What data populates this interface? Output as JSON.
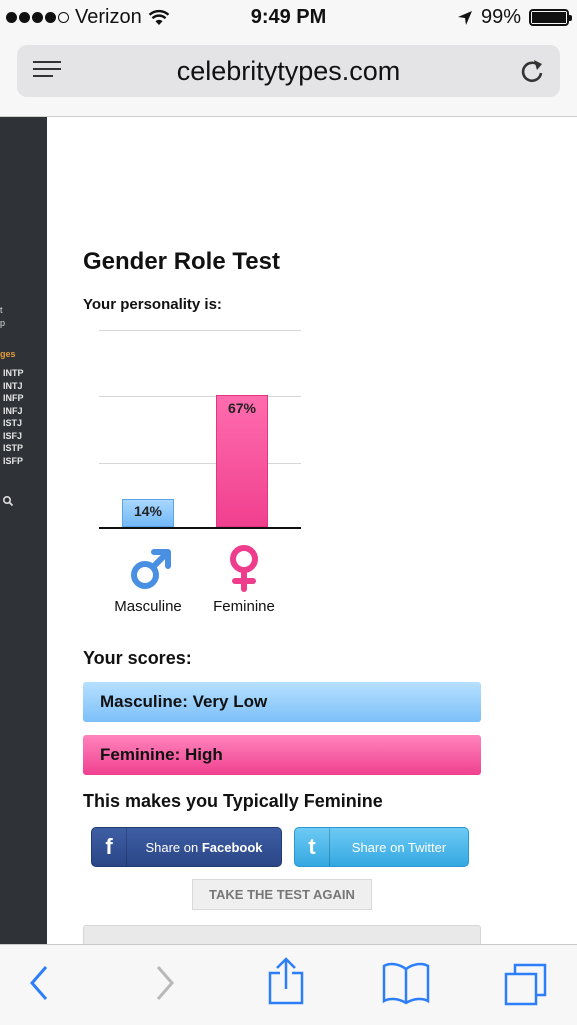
{
  "status_bar": {
    "carrier": "Verizon",
    "time": "9:49 PM",
    "battery_percent": "99%",
    "battery_level": 0.99
  },
  "browser": {
    "url": "celebritytypes.com"
  },
  "sidebar": {
    "fragments": [
      "t",
      "p",
      "ges"
    ],
    "types": [
      "INTP",
      "INTJ",
      "INFP",
      "INFJ",
      "ISTJ",
      "ISFJ",
      "ISTP",
      "ISFP"
    ]
  },
  "page": {
    "title": "Gender Role Test",
    "subtitle": "Your personality is:",
    "scores_heading": "Your scores:",
    "score_masculine": "Masculine: Very Low",
    "score_feminine": "Feminine: High",
    "result": "This makes you Typically Feminine",
    "share_facebook_prefix": "Share on ",
    "share_facebook_brand": "Facebook",
    "share_twitter": "Share on Twitter",
    "take_again": "TAKE THE TEST AGAIN"
  },
  "chart_data": {
    "type": "bar",
    "categories": [
      "Masculine",
      "Feminine"
    ],
    "values": [
      14,
      67
    ],
    "value_labels": [
      "14%",
      "67%"
    ],
    "ylim": [
      0,
      100
    ],
    "grid": true,
    "colors": [
      "#7cc0f9",
      "#f0408f"
    ]
  },
  "colors": {
    "masculine": "#4a90e2",
    "feminine": "#ee3d8c",
    "facebook": "#2f4b8c",
    "twitter": "#3aa9e0"
  },
  "icons": [
    "wifi-icon",
    "location-arrow-icon",
    "battery-icon",
    "menu-icon",
    "reload-icon",
    "male-symbol-icon",
    "female-symbol-icon",
    "facebook-icon",
    "twitter-icon",
    "back-icon",
    "forward-icon",
    "share-icon",
    "bookmarks-icon",
    "tabs-icon",
    "search-icon"
  ]
}
